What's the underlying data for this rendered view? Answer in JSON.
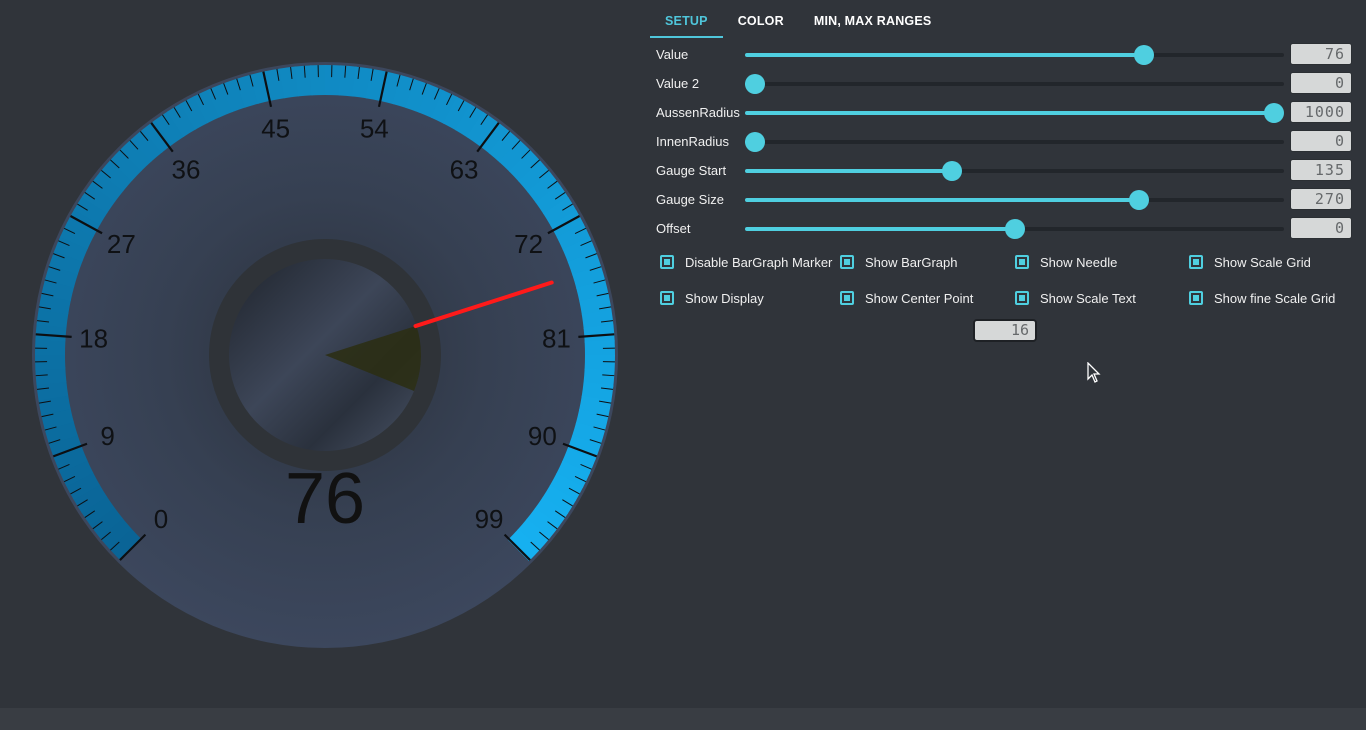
{
  "gauge": {
    "value": 76,
    "value_display": "76",
    "scale_labels": [
      "0",
      "9",
      "18",
      "27",
      "36",
      "45",
      "54",
      "63",
      "72",
      "81",
      "90",
      "99"
    ],
    "colors": {
      "bar": "#16aef0",
      "bar_dark": "#0b6fa6",
      "needle": "#ff1a1a",
      "face": "#3a4458"
    }
  },
  "tabs": [
    {
      "label": "SETUP",
      "active": true
    },
    {
      "label": "COLOR",
      "active": false
    },
    {
      "label": "MIN, MAX RANGES",
      "active": false
    }
  ],
  "sliders": [
    {
      "label": "Value",
      "display": "76",
      "fraction": 0.75
    },
    {
      "label": "Value 2",
      "display": "0",
      "fraction": 0.0
    },
    {
      "label": "AussenRadius",
      "display": "1000",
      "fraction": 1.0
    },
    {
      "label": "InnenRadius",
      "display": "0",
      "fraction": 0.0
    },
    {
      "label": "Gauge Start",
      "display": "135",
      "fraction": 0.38
    },
    {
      "label": "Gauge Size",
      "display": "270",
      "fraction": 0.74
    },
    {
      "label": "Offset",
      "display": "0",
      "fraction": 0.5
    }
  ],
  "checkboxes": [
    {
      "label": "Disable BarGraph Marker",
      "checked": true
    },
    {
      "label": "Show BarGraph",
      "checked": true
    },
    {
      "label": "Show Needle",
      "checked": true
    },
    {
      "label": "Show Scale Grid",
      "checked": true
    },
    {
      "label": "Show Display",
      "checked": true
    },
    {
      "label": "Show Center Point",
      "checked": true
    },
    {
      "label": "Show Scale Text",
      "checked": true
    },
    {
      "label": "Show fine Scale Grid",
      "checked": true
    }
  ],
  "extra_display": "16",
  "accent": "#4fcfe0"
}
